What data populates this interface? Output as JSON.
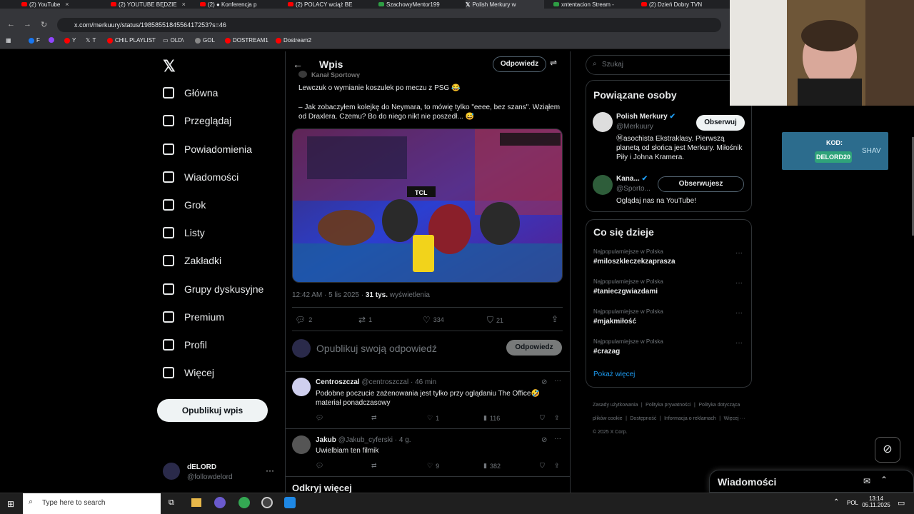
{
  "browser": {
    "tabs": [
      {
        "label": "(2) YouTube",
        "color": "#ff0000"
      },
      {
        "label": "(2) YOUTUBE BĘDZIE",
        "color": "#ff0000"
      },
      {
        "label": "(2) ● Konferencja p",
        "color": "#ff0000"
      },
      {
        "label": "(2) POLACY wciąż BE",
        "color": "#ff0000"
      },
      {
        "label": "SzachowyMentor199",
        "color": "#2e9e44"
      },
      {
        "label": "Polish Merkury w",
        "color": "#ffffff"
      },
      {
        "label": "xntentacion Stream -",
        "color": "#2e9e44"
      },
      {
        "label": "(2) Dzień Dobry TVN",
        "color": "#ff0000"
      }
    ],
    "url": "x.com/merkuury/status/1985855184556417253?s=46",
    "bookmarks": [
      "F",
      "Y",
      "T",
      "CHIL PLAYLIST",
      "OLD\\",
      "GOL",
      "DOSTREAM1",
      "Dostream2"
    ]
  },
  "nav": {
    "items": [
      {
        "label": "Główna",
        "icon": "home-icon"
      },
      {
        "label": "Przeglądaj",
        "icon": "search-icon"
      },
      {
        "label": "Powiadomienia",
        "icon": "bell-icon"
      },
      {
        "label": "Wiadomości",
        "icon": "mail-icon"
      },
      {
        "label": "Grok",
        "icon": "grok-icon"
      },
      {
        "label": "Listy",
        "icon": "list-icon"
      },
      {
        "label": "Zakładki",
        "icon": "bookmark-icon"
      },
      {
        "label": "Grupy dyskusyjne",
        "icon": "people-icon"
      },
      {
        "label": "Premium",
        "icon": "x-icon"
      },
      {
        "label": "Profil",
        "icon": "user-icon"
      },
      {
        "label": "Więcej",
        "icon": "more-icon"
      }
    ],
    "post_button": "Opublikuj wpis",
    "account": {
      "name": "dELORD",
      "handle": "@followdelord"
    }
  },
  "post": {
    "header_title": "Wpis",
    "reply_label": "Odpowiedz",
    "author_partial": "Kanał Sportowy",
    "text_line1": "Lewczuk o wymianie koszulek po meczu z PSG 😂",
    "text_line2": "– Jak zobaczyłem kolejkę do Neymara, to mówię tylko \"eeee, bez szans\". Wziąłem od Draxlera. Czemu? Bo do niego nikt nie poszedł... 😅",
    "meta_time": "12:42 AM · 5 lis 2025 · ",
    "meta_views": "31 tys.",
    "meta_views_suffix": " wyświetlenia",
    "stats": {
      "replies": "2",
      "reposts": "1",
      "likes": "334",
      "bookmarks": "21"
    },
    "reply_placeholder": "Opublikuj swoją odpowiedź",
    "reply_button": "Odpowiedz"
  },
  "replies": [
    {
      "name": "Centroszczal",
      "handle": "@centroszczal · 46 min",
      "text": "Podobne poczucie zażenowania jest tylko przy oglądaniu The Office🤣 materiał ponadczasowy",
      "likes": "1",
      "views": "116"
    },
    {
      "name": "Jakub",
      "handle": "@Jakub_cyferski · 4 g.",
      "text": "Uwielbiam ten filmik",
      "likes": "9",
      "views": "382"
    }
  ],
  "discover_more": "Odkryj więcej",
  "right": {
    "search_placeholder": "Szukaj",
    "related_title": "Powiązane osoby",
    "people": [
      {
        "name": "Polish Merkury",
        "handle": "@Merkuury",
        "button": "Obserwuj",
        "bio": "Ⓜasochista Ekstraklasy. Pierwszą planetą od słońca jest Merkury. Miłośnik Piły i Johna Kramera."
      },
      {
        "name": "Kana...",
        "handle": "@Sporto...",
        "button": "Obserwujesz",
        "bio": "Oglądaj nas na YouTube!"
      }
    ],
    "trends_title": "Co się dzieje",
    "trends": [
      {
        "meta": "Najpopularniejsze w Polska",
        "tag": "#miloszkleczekzaprasza"
      },
      {
        "meta": "Najpopularniejsze w Polska",
        "tag": "#tanieczgwiazdami"
      },
      {
        "meta": "Najpopularniejsze w Polska",
        "tag": "#mjakmiłość"
      },
      {
        "meta": "Najpopularniejsze w Polska",
        "tag": "#crazag"
      }
    ],
    "show_more": "Pokaż więcej",
    "footer": [
      "Zasady użytkowania",
      "Polityka prywatności",
      "Polityka dotycząca plików cookie",
      "Dostępność",
      "Informacja o reklamach",
      "Więcej ···",
      "© 2025 X Corp."
    ]
  },
  "promo": {
    "label": "KOD:",
    "code": "DELORD20",
    "brand": "SHAV"
  },
  "messages_bar": "Wiadomości",
  "taskbar": {
    "search_placeholder": "Type here to search",
    "lang": "POL",
    "time": "13:14",
    "date": "05.11.2025"
  }
}
